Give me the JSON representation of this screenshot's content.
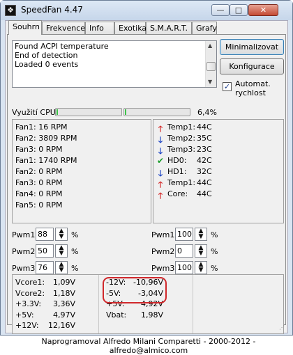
{
  "window": {
    "title": "SpeedFan 4.47",
    "app_icon": "fan-icon",
    "caption": {
      "minimize": "—",
      "maximize": "□",
      "close": "✕"
    }
  },
  "tabs": [
    "Souhrn",
    "Frekvence",
    "Info",
    "Exotika",
    "S.M.A.R.T.",
    "Grafy"
  ],
  "active_tab": "Souhrn",
  "log": {
    "lines": [
      "Found ACPI temperature",
      "End of detection",
      "Loaded 0 events"
    ]
  },
  "buttons": {
    "minimize": "Minimalizovat",
    "configure": "Konfigurace"
  },
  "auto_speed": {
    "label": "Automat. rychlost",
    "checked": true
  },
  "cpu": {
    "label": "Využití CPU",
    "value": "6,4%",
    "bars": [
      0.02,
      0.02
    ],
    "bar_color": "#3cc24a"
  },
  "fans": [
    {
      "name": "Fan1",
      "value": "16 RPM"
    },
    {
      "name": "Fan2",
      "value": "3809 RPM"
    },
    {
      "name": "Fan3",
      "value": "0 RPM"
    },
    {
      "name": "Fan1",
      "value": "1740 RPM"
    },
    {
      "name": "Fan2",
      "value": "0 RPM"
    },
    {
      "name": "Fan3",
      "value": "0 RPM"
    },
    {
      "name": "Fan4",
      "value": "0 RPM"
    },
    {
      "name": "Fan5",
      "value": "0 RPM"
    }
  ],
  "temps": [
    {
      "icon": "arrow-up-icon",
      "name": "Temp1:",
      "value": "44C",
      "color": "#d42a2a"
    },
    {
      "icon": "arrow-down-icon",
      "name": "Temp2:",
      "value": "35C",
      "color": "#1d45c4"
    },
    {
      "icon": "arrow-down-icon",
      "name": "Temp3:",
      "value": "23C",
      "color": "#1d45c4"
    },
    {
      "icon": "check-icon",
      "name": "HD0:",
      "value": "42C",
      "color": "#1a9c2b"
    },
    {
      "icon": "arrow-down-icon",
      "name": "HD1:",
      "value": "32C",
      "color": "#1d45c4"
    },
    {
      "icon": "arrow-up-icon",
      "name": "Temp1:",
      "value": "44C",
      "color": "#d42a2a"
    },
    {
      "icon": "arrow-up-icon",
      "name": "Core:",
      "value": "44C",
      "color": "#d42a2a"
    }
  ],
  "pwm_left": [
    {
      "label": "Pwm1:",
      "value": "88"
    },
    {
      "label": "Pwm2:",
      "value": "50"
    },
    {
      "label": "Pwm3:",
      "value": "76"
    }
  ],
  "pwm_right": [
    {
      "label": "Pwm1:",
      "value": "100"
    },
    {
      "label": "Pwm2:",
      "value": "0"
    },
    {
      "label": "Pwm3:",
      "value": "100"
    }
  ],
  "pwm_unit": "%",
  "voltages_col1": [
    {
      "name": "Vcore1:",
      "value": "1,09V"
    },
    {
      "name": "Vcore2:",
      "value": "1,18V"
    },
    {
      "name": "+3.3V:",
      "value": "3,36V"
    },
    {
      "name": "+5V:",
      "value": "4,97V"
    },
    {
      "name": "+12V:",
      "value": "12,16V"
    }
  ],
  "voltages_col2": [
    {
      "name": "-12V:",
      "value": "-10,96V"
    },
    {
      "name": "-5V:",
      "value": "-3,04V"
    },
    {
      "name": "+5V:",
      "value": "4,92V"
    },
    {
      "name": "Vbat:",
      "value": "1,98V"
    }
  ],
  "highlight_color": "#d0282b",
  "footer": "Naprogramoval Alfredo Milani Comparetti - 2000-2012 - alfredo@almico.com"
}
